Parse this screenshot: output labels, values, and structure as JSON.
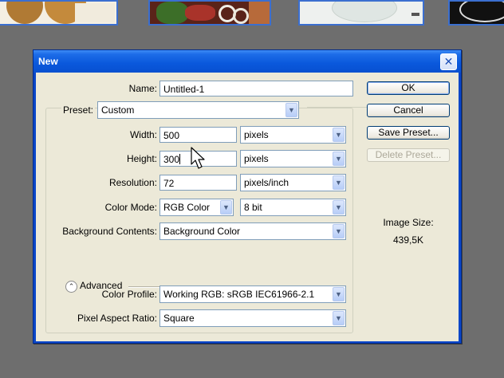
{
  "dialog": {
    "title": "New",
    "close_glyph": "✕",
    "name": {
      "label": "Name:",
      "value": "Untitled-1"
    },
    "preset": {
      "label": "Preset:",
      "value": "Custom"
    },
    "width": {
      "label": "Width:",
      "value": "500",
      "unit": "pixels"
    },
    "height": {
      "label": "Height:",
      "value": "300",
      "unit": "pixels"
    },
    "resolution": {
      "label": "Resolution:",
      "value": "72",
      "unit": "pixels/inch"
    },
    "color_mode": {
      "label": "Color Mode:",
      "value": "RGB Color",
      "depth": "8 bit"
    },
    "background": {
      "label": "Background Contents:",
      "value": "Background Color"
    },
    "advanced": {
      "label": "Advanced",
      "icon": "collapse-chevrons-icon"
    },
    "color_profile": {
      "label": "Color Profile:",
      "value": "Working RGB:  sRGB IEC61966-2.1"
    },
    "pixel_aspect": {
      "label": "Pixel Aspect Ratio:",
      "value": "Square"
    },
    "buttons": {
      "ok": "OK",
      "cancel": "Cancel",
      "save_preset": "Save Preset...",
      "delete_preset": "Delete Preset..."
    },
    "image_size": {
      "label": "Image Size:",
      "value": "439,5K"
    }
  },
  "colors": {
    "title_bar": "#0a58dc",
    "dialog_bg": "#ece9d8",
    "desktop": "#6e6e6e"
  }
}
